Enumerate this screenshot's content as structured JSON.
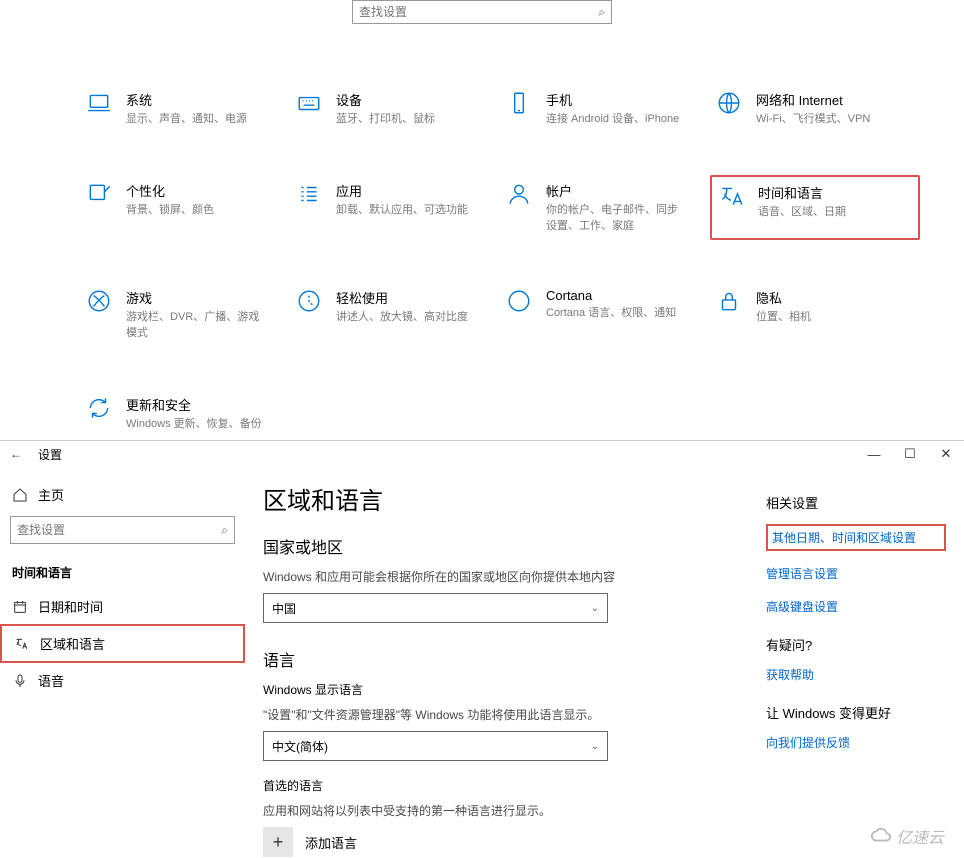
{
  "top_search_placeholder": "查找设置",
  "categories": [
    {
      "key": "system",
      "title": "系统",
      "sub": "显示、声音、通知、电源"
    },
    {
      "key": "devices",
      "title": "设备",
      "sub": "蓝牙、打印机、鼠标"
    },
    {
      "key": "phone",
      "title": "手机",
      "sub": "连接 Android 设备、iPhone"
    },
    {
      "key": "network",
      "title": "网络和 Internet",
      "sub": "Wi-Fi、飞行模式、VPN"
    },
    {
      "key": "personal",
      "title": "个性化",
      "sub": "背景、锁屏、颜色"
    },
    {
      "key": "apps",
      "title": "应用",
      "sub": "卸载、默认应用、可选功能"
    },
    {
      "key": "accounts",
      "title": "帐户",
      "sub": "你的帐户、电子邮件、同步设置、工作、家庭"
    },
    {
      "key": "timelang",
      "title": "时间和语言",
      "sub": "语音、区域、日期",
      "highlight": true
    },
    {
      "key": "gaming",
      "title": "游戏",
      "sub": "游戏栏、DVR、广播、游戏模式"
    },
    {
      "key": "ease",
      "title": "轻松使用",
      "sub": "讲述人、放大镜、高对比度"
    },
    {
      "key": "cortana",
      "title": "Cortana",
      "sub": "Cortana 语言、权限、通知"
    },
    {
      "key": "privacy",
      "title": "隐私",
      "sub": "位置、相机"
    },
    {
      "key": "update",
      "title": "更新和安全",
      "sub": "Windows 更新、恢复、备份"
    }
  ],
  "win": {
    "title": "设置",
    "home": "主页",
    "side_search_placeholder": "查找设置",
    "section": "时间和语言",
    "nav": [
      {
        "key": "datetime",
        "label": "日期和时间"
      },
      {
        "key": "region",
        "label": "区域和语言",
        "selected": true
      },
      {
        "key": "speech",
        "label": "语音"
      }
    ],
    "page": {
      "h1": "区域和语言",
      "country_h2": "国家或地区",
      "country_desc": "Windows 和应用可能会根据你所在的国家或地区向你提供本地内容",
      "country_value": "中国",
      "lang_h2": "语言",
      "display_lang_label": "Windows 显示语言",
      "display_lang_desc": "\"设置\"和\"文件资源管理器\"等 Windows 功能将使用此语言显示。",
      "display_lang_value": "中文(简体)",
      "preferred_h": "首选的语言",
      "preferred_desc": "应用和网站将以列表中受支持的第一种语言进行显示。",
      "add_label": "添加语言"
    },
    "right": {
      "related_h": "相关设置",
      "link1": "其他日期、时间和区域设置",
      "link2": "管理语言设置",
      "link3": "高级键盘设置",
      "help_h": "有疑问?",
      "help_link": "获取帮助",
      "better_h": "让 Windows 变得更好",
      "feedback": "向我们提供反馈"
    }
  },
  "watermark": "亿速云"
}
